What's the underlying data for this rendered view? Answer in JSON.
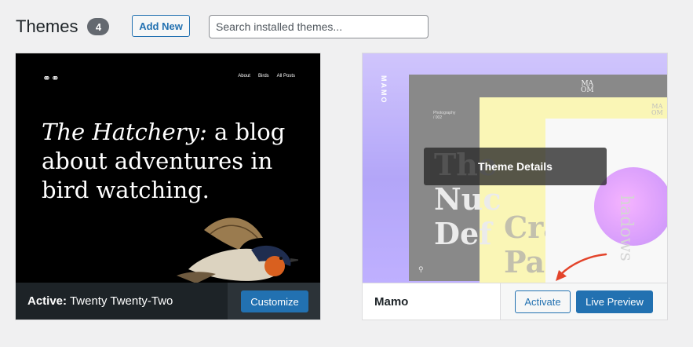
{
  "header": {
    "title": "Themes",
    "count": "4",
    "add_new": "Add New",
    "search_placeholder": "Search installed themes..."
  },
  "active_theme": {
    "nav": [
      "About",
      "Birds",
      "All Posts"
    ],
    "headline_italic": "The Hatchery:",
    "headline_rest": " a blog about adventures in bird watching.",
    "active_prefix": "Active:",
    "name": "Twenty Twenty-Two",
    "customize_label": "Customize"
  },
  "theme2": {
    "side_label": "MAMO",
    "preview_big_1": "The\nNuc\nDef",
    "preview_big_2": "Cra\nPat",
    "preview_small_1": "Photography\n/ 002",
    "preview_vertical": "hadows",
    "brand_top": "MA\nOM",
    "brand_second": "MA\nOM",
    "details_label": "Theme Details",
    "name": "Mamo",
    "activate_label": "Activate",
    "live_preview_label": "Live Preview"
  },
  "colors": {
    "primary": "#2271b1",
    "active_bar": "#1d2327",
    "arrow": "#e3442b"
  }
}
